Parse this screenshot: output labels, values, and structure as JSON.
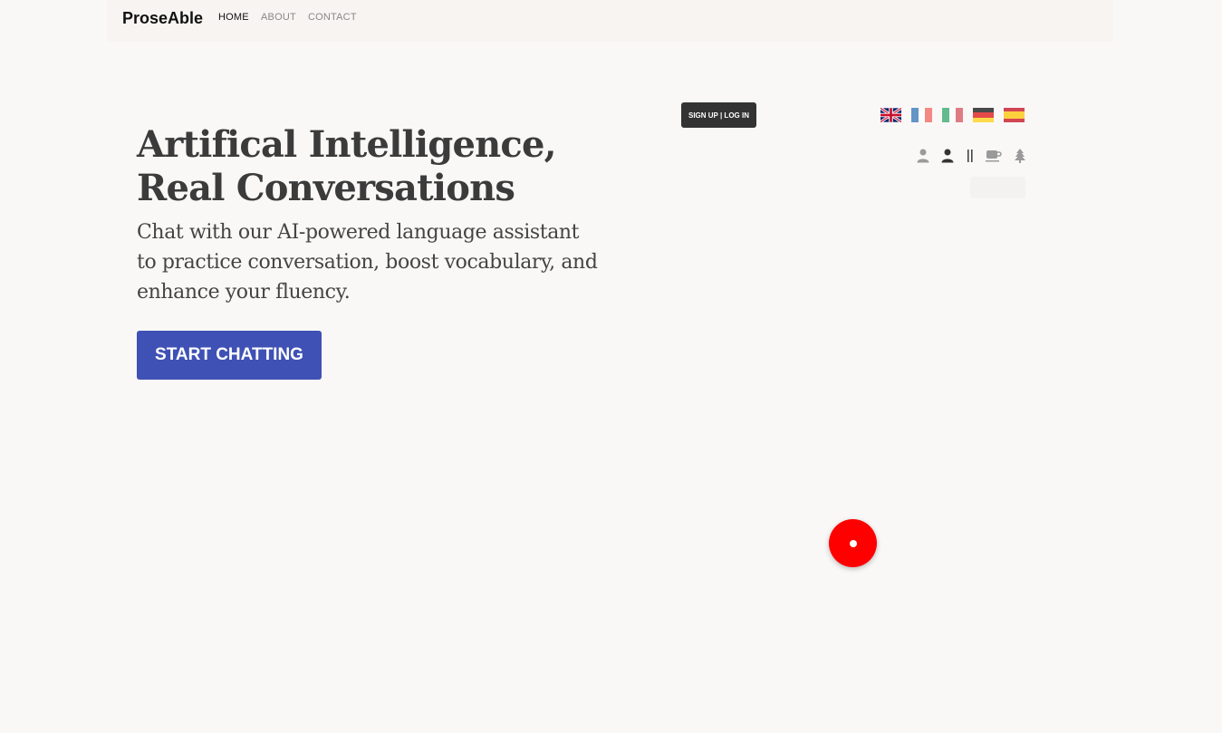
{
  "nav": {
    "brand": "ProseAble",
    "links": [
      {
        "label": "HOME",
        "active": true
      },
      {
        "label": "ABOUT",
        "active": false
      },
      {
        "label": "CONTACT",
        "active": false
      }
    ]
  },
  "hero": {
    "title_line1": "Artifical Intelligence,",
    "title_line2": "Real Conversations",
    "subtitle": "Chat with our AI-powered language assistant to practice conversation, boost vocabulary, and enhance your fluency.",
    "cta_label": "START CHATTING"
  },
  "auth": {
    "signup_label": "SIGN UP | LOG IN"
  },
  "languages": [
    "English",
    "French",
    "Italian",
    "German",
    "Spanish"
  ],
  "toolbar_icons": [
    "person-icon",
    "person-active-icon",
    "pause-icon",
    "coffee-icon",
    "tree-icon"
  ],
  "colors": {
    "accent": "#3f51b5",
    "record": "#ff0000",
    "dark_button": "#333333"
  }
}
